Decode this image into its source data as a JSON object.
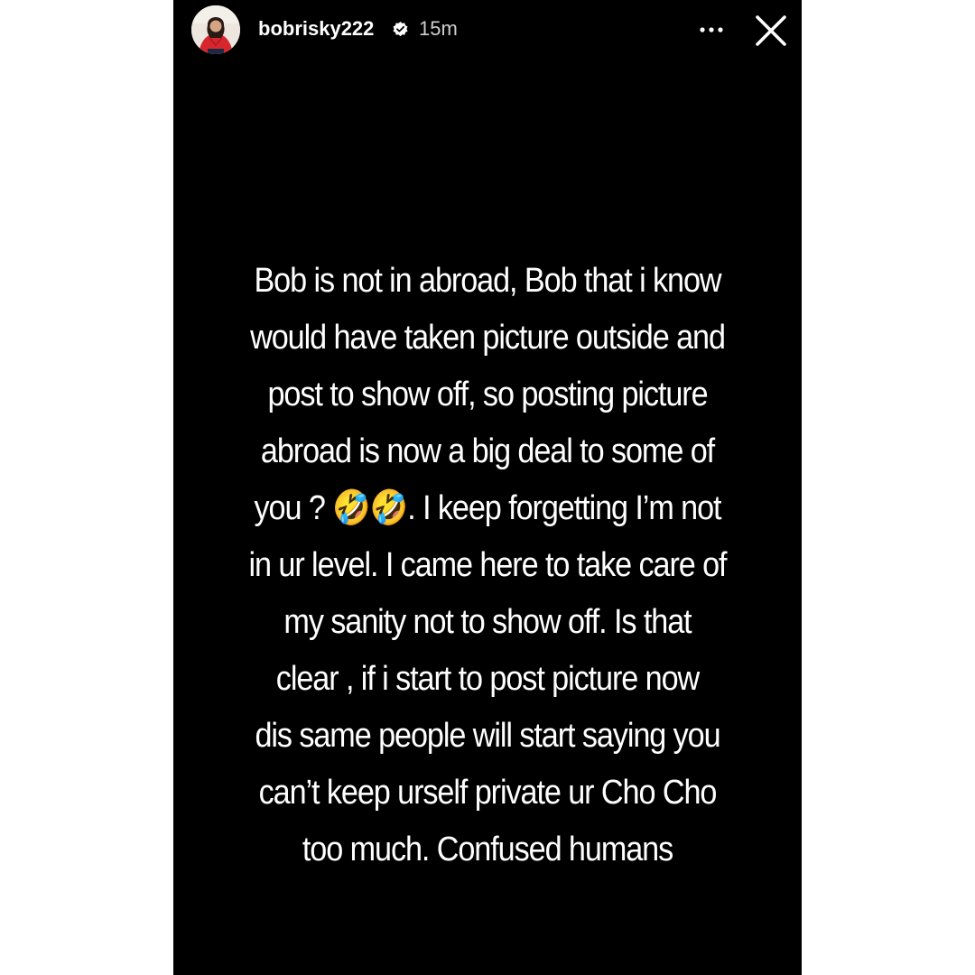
{
  "story": {
    "username": "bobrisky222",
    "verified": true,
    "timestamp": "15m",
    "avatar_icon": "profile-photo",
    "more_icon": "more-horizontal-icon",
    "close_icon": "close-icon",
    "caption_lines": [
      "Bob is not in abroad, Bob that i know",
      "would have taken picture outside and",
      "post to show off, so posting picture",
      "abroad is now a big deal to some of",
      "you ? 🤣🤣. I keep forgetting I’m not",
      "in ur level. I came here to take care of",
      "my sanity not to show off. Is that",
      "clear , if i start to post picture now",
      "dis same people will start saying you",
      "can’t keep urself private ur Cho Cho",
      "too much. Confused humans"
    ]
  },
  "colors": {
    "page_background": "#ffffff",
    "story_background": "#000000",
    "text": "#ffffff",
    "timestamp": "#cfcfcf",
    "verified_badge": "#ffffff"
  }
}
